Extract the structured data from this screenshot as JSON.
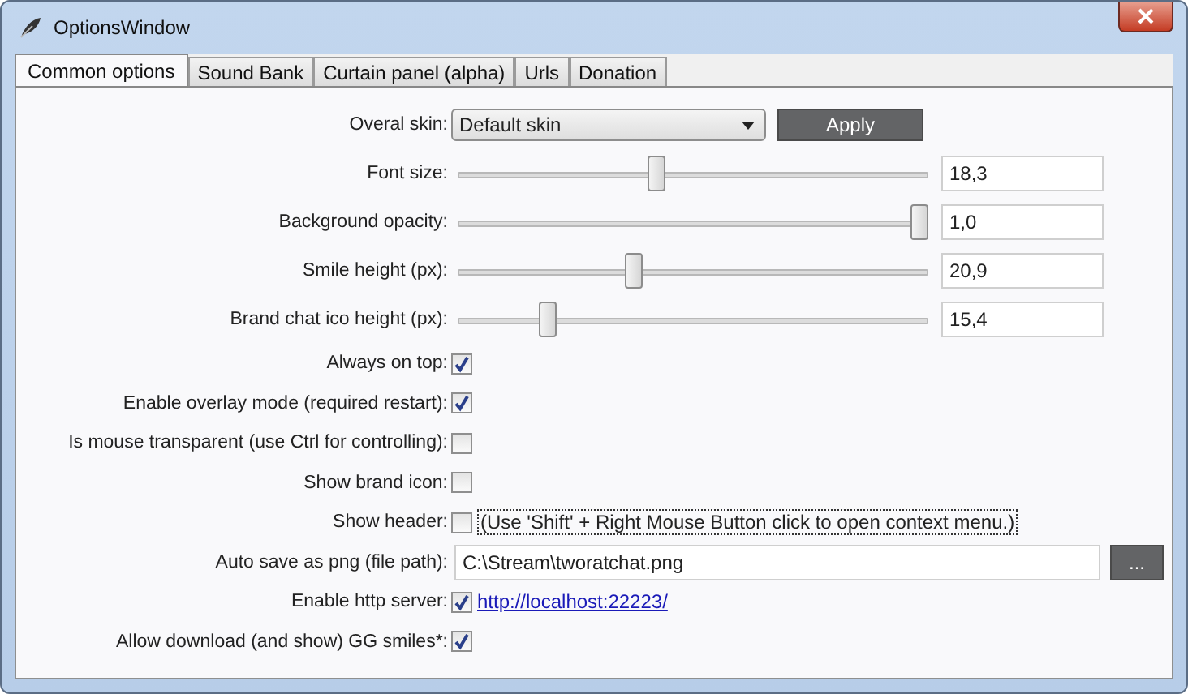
{
  "window": {
    "title": "OptionsWindow"
  },
  "tabs": [
    {
      "label": "Common options",
      "selected": true
    },
    {
      "label": "Sound Bank",
      "selected": false
    },
    {
      "label": "Curtain panel (alpha)",
      "selected": false
    },
    {
      "label": "Urls",
      "selected": false
    },
    {
      "label": "Donation",
      "selected": false
    }
  ],
  "options": [
    {
      "kind": "dropdown",
      "label": "Overal skin:",
      "value": "Default skin",
      "button": "Apply"
    },
    {
      "kind": "slider",
      "label": "Font size:",
      "level": 0.42,
      "value": "18,3"
    },
    {
      "kind": "slider",
      "label": "Background opacity:",
      "level": 1.0,
      "value": "1,0"
    },
    {
      "kind": "slider",
      "label": "Smile height (px):",
      "level": 0.37,
      "value": "20,9"
    },
    {
      "kind": "slider",
      "label": "Brand chat ico height (px):",
      "level": 0.18,
      "value": "15,4"
    },
    {
      "kind": "checkbox",
      "label": "Always on top:",
      "checked": true
    },
    {
      "kind": "checkbox",
      "label": "Enable overlay mode (required restart):",
      "checked": true
    },
    {
      "kind": "checkbox",
      "label": "Is mouse transparent (use Ctrl for controlling):",
      "checked": false
    },
    {
      "kind": "checkbox",
      "label": "Show brand icon:",
      "checked": false
    },
    {
      "kind": "checkbox",
      "label": "Show header:",
      "checked": false,
      "note": "(Use 'Shift' + Right Mouse Button click to open context menu.)"
    },
    {
      "kind": "file",
      "label": "Auto save as png (file path):",
      "value": "C:\\Stream\\tworatchat.png",
      "button": "..."
    },
    {
      "kind": "checkbox",
      "label": "Enable http server:",
      "checked": true,
      "link": "http://localhost:22223/"
    },
    {
      "kind": "checkbox",
      "label": "Allow download (and show) GG smiles*:",
      "checked": true
    }
  ]
}
